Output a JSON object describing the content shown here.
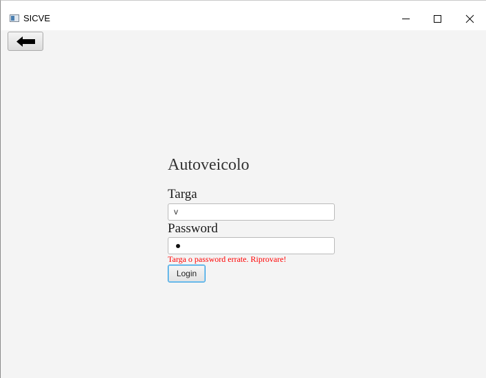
{
  "window": {
    "title": "SICVE",
    "icons": {
      "app": "app-window-icon",
      "minimize": "minimize-icon",
      "maximize": "maximize-icon",
      "close": "close-icon"
    }
  },
  "toolbar": {
    "back_icon": "arrow-left-icon"
  },
  "form": {
    "title": "Autoveicolo",
    "targa_label": "Targa",
    "targa_value": "v",
    "password_label": "Password",
    "password_value_masked": "•",
    "error_message": "Targa o password errate. Riprovare!",
    "login_label": "Login"
  },
  "colors": {
    "error": "#ff0000",
    "focus_border": "#2a9be0",
    "background": "#f4f4f4"
  }
}
